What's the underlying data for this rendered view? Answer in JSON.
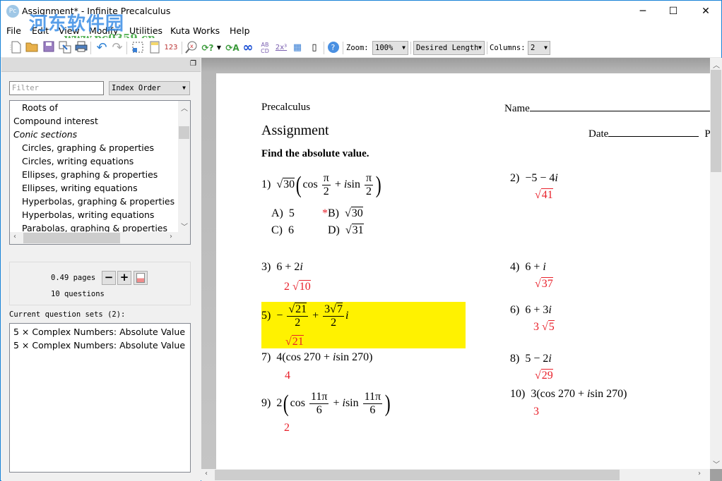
{
  "window": {
    "title": "Assignment* - Infinite Precalculus",
    "app_icon": "Pc",
    "controls": {
      "minimize": "─",
      "maximize": "☐",
      "close": "✕"
    }
  },
  "watermark": {
    "text": "河东软件园",
    "url_text": "www.pc0359.cn"
  },
  "menubar": [
    "File",
    "Edit",
    "View",
    "Modify",
    "Utilities",
    "Kuta Works",
    "Help"
  ],
  "toolbar": {
    "icons": [
      "new-document",
      "open-folder",
      "save",
      "export",
      "print",
      "undo",
      "redo",
      "select-region",
      "properties",
      "numbering",
      "find-replace",
      "regenerate",
      "dropdown",
      "regenerate-choices",
      "infinity",
      "abcd-choices",
      "power",
      "presentation",
      "column-layout",
      "help"
    ],
    "numbering_label": "123",
    "abcd_label": "AB CD",
    "power_label": "2x³",
    "zoom_label": "Zoom:",
    "zoom_value": "100%",
    "length_value": "Desired Length",
    "columns_label": "Columns:",
    "columns_value": "2"
  },
  "left_panel": {
    "filter_placeholder": "Filter",
    "order_value": "Index Order",
    "topics": [
      {
        "label": "Roots of",
        "level": 1,
        "italic": false
      },
      {
        "label": "Compound interest",
        "level": 0,
        "italic": false
      },
      {
        "label": "Conic sections",
        "level": 0,
        "italic": true
      },
      {
        "label": "Circles, graphing & properties",
        "level": 1,
        "italic": false
      },
      {
        "label": "Circles, writing equations",
        "level": 1,
        "italic": false
      },
      {
        "label": "Ellipses, graphing & properties",
        "level": 1,
        "italic": false
      },
      {
        "label": "Ellipses, writing equations",
        "level": 1,
        "italic": false
      },
      {
        "label": "Hyperbolas, graphing & properties",
        "level": 1,
        "italic": false
      },
      {
        "label": "Hyperbolas, writing equations",
        "level": 1,
        "italic": false
      },
      {
        "label": "Parabolas, graphing & properties",
        "level": 1,
        "italic": false
      }
    ],
    "pages": "0.49 pages",
    "questions": "10 questions",
    "minus": "−",
    "plus": "+",
    "sets_label": "Current question sets (2):",
    "sets": [
      "5 × Complex Numbers: Absolute Value",
      "5 × Complex Numbers: Absolute Value"
    ]
  },
  "worksheet": {
    "course": "Precalculus",
    "name_label": "Name",
    "title": "Assignment",
    "date_label": "Date",
    "period_label": "P",
    "instructions": "Find the absolute value.",
    "questions": [
      {
        "num": "1)",
        "choices": {
          "A": "5",
          "B": "30",
          "C": "6",
          "D": "31"
        },
        "correct": "B",
        "marker": "*"
      },
      {
        "num": "2)",
        "expr": "−5 − 4",
        "i": "i",
        "answer": "41"
      },
      {
        "num": "3)",
        "expr": "6 + 2",
        "i": "i",
        "answer_coef": "2",
        "answer": "10"
      },
      {
        "num": "4)",
        "expr": "6 + ",
        "i": "i",
        "answer": "37"
      },
      {
        "num": "5)",
        "answer": "21",
        "highlighted": true
      },
      {
        "num": "6)",
        "expr": "6 + 3",
        "i": "i",
        "answer_coef": "3",
        "answer": "5"
      },
      {
        "num": "7)",
        "expr": "4(cos 270 + ",
        "i": "i",
        "expr2": "sin 270)",
        "answer": "4"
      },
      {
        "num": "8)",
        "expr": "5 − 2",
        "i": "i",
        "answer": "29"
      },
      {
        "num": "9)",
        "answer": "2"
      },
      {
        "num": "10)",
        "expr": "3(cos 270 + ",
        "i": "i",
        "expr2": "sin 270)",
        "answer": "3"
      }
    ],
    "highlight_color": "#fff200",
    "answer_color": "#e8202a"
  }
}
